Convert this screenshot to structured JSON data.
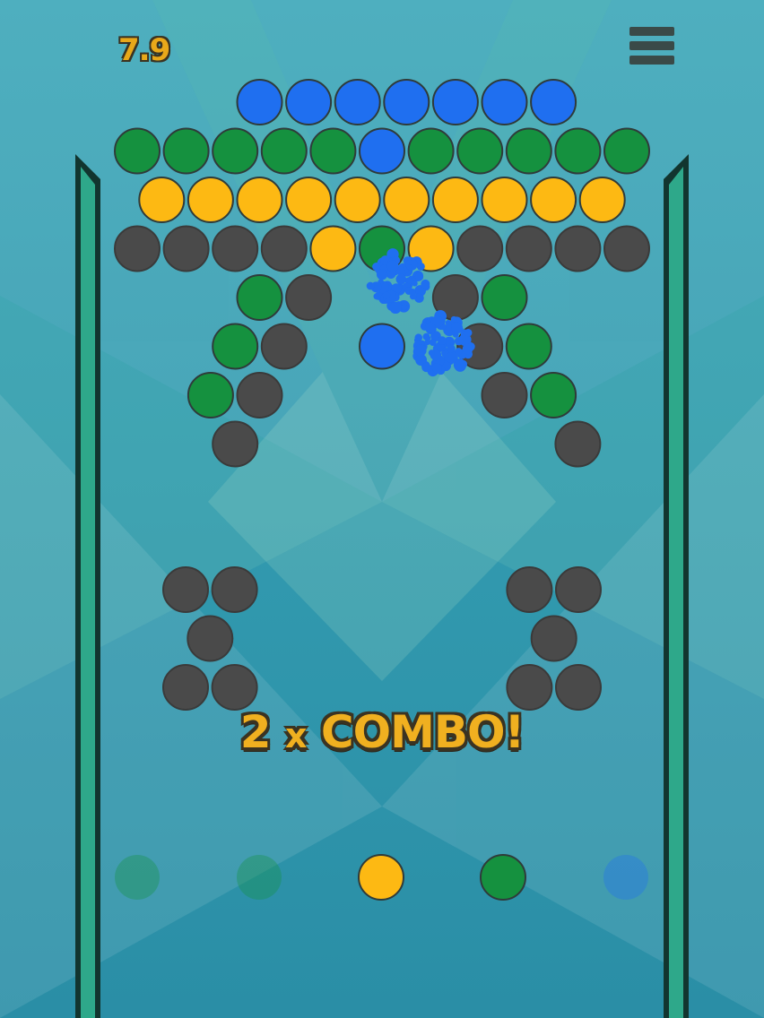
{
  "hud": {
    "score": "7.9",
    "menu_icon": "hamburger-menu-icon"
  },
  "combo": {
    "count": "2",
    "multiplier": "x",
    "label": "COMBO!"
  },
  "colors": {
    "blue": "#1f6ff0",
    "green": "#15913f",
    "yellow": "#fdb913",
    "gray": "#4a4a4a",
    "wall": "#2ea88a",
    "wall_dark": "#12352f"
  },
  "grid": {
    "rows": [
      {
        "offset": 1,
        "cells": [
          "blue",
          "blue",
          "blue",
          "blue",
          "blue",
          "blue",
          "blue"
        ],
        "start": 2
      },
      {
        "offset": 0,
        "cells": [
          "green",
          "green",
          "green",
          "green",
          "green",
          "blue",
          "green",
          "green",
          "green",
          "green",
          "green"
        ],
        "start": 0
      },
      {
        "offset": 1,
        "cells": [
          "yellow",
          "yellow",
          "yellow",
          "yellow",
          "yellow",
          "yellow",
          "yellow",
          "yellow",
          "yellow",
          "yellow"
        ],
        "start": 0
      },
      {
        "offset": 0,
        "cells": [
          "gray",
          "gray",
          "gray",
          "gray",
          "yellow",
          "green",
          "yellow",
          "gray",
          "gray",
          "gray",
          "gray"
        ],
        "start": 0
      },
      {
        "offset": 1,
        "cells": [
          "green",
          "gray",
          null,
          null,
          "gray",
          "green"
        ],
        "start": 2
      },
      {
        "offset": 0,
        "cells": [
          "green",
          "gray",
          null,
          "blue",
          null,
          "gray",
          "green"
        ],
        "start": 2
      },
      {
        "offset": 1,
        "cells": [
          "green",
          "gray",
          null,
          null,
          null,
          null,
          "gray",
          "green"
        ],
        "start": 1
      },
      {
        "offset": 0,
        "cells": [
          "gray",
          null,
          null,
          null,
          null,
          null,
          null,
          "gray"
        ],
        "start": 2
      }
    ],
    "clusters": [
      {
        "row": 0,
        "col": 1,
        "cells": [
          "gray",
          "gray"
        ]
      },
      {
        "row": 1,
        "col": 1,
        "cells": [
          "gray"
        ]
      },
      {
        "row": 2,
        "col": 1,
        "cells": [
          "gray",
          "gray"
        ]
      }
    ]
  },
  "queue": [
    {
      "color": "green",
      "state": "faded"
    },
    {
      "color": "green",
      "state": "faded"
    },
    {
      "color": "yellow",
      "state": "active"
    },
    {
      "color": "green",
      "state": "next"
    },
    {
      "color": "blue",
      "state": "faded"
    }
  ]
}
